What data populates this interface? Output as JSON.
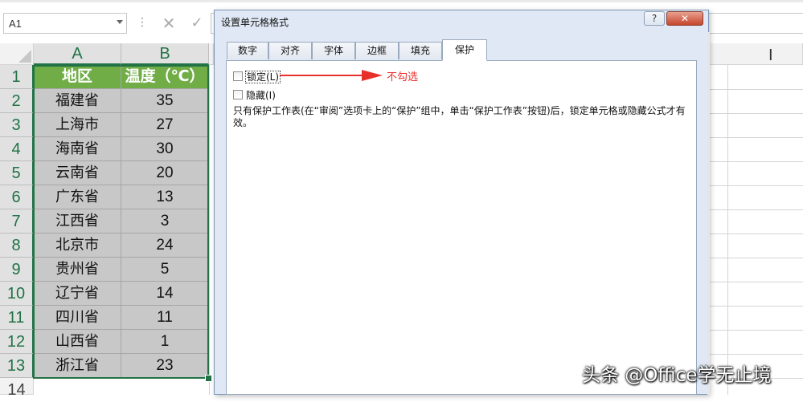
{
  "formula_bar": {
    "name_box": "A1",
    "cancel_icon": "✕",
    "enter_icon": "✓",
    "fx_dots": "⋮"
  },
  "sheet": {
    "columns": [
      "A",
      "B"
    ],
    "rows": [
      "1",
      "2",
      "3",
      "4",
      "5",
      "6",
      "7",
      "8",
      "9",
      "10",
      "11",
      "12",
      "13",
      "14"
    ],
    "header_row": [
      "地区",
      "温度（℃）"
    ],
    "data": [
      [
        "福建省",
        "35"
      ],
      [
        "上海市",
        "27"
      ],
      [
        "海南省",
        "30"
      ],
      [
        "云南省",
        "20"
      ],
      [
        "广东省",
        "13"
      ],
      [
        "江西省",
        "3"
      ],
      [
        "北京市",
        "24"
      ],
      [
        "贵州省",
        "5"
      ],
      [
        "辽宁省",
        "14"
      ],
      [
        "四川省",
        "11"
      ],
      [
        "山西省",
        "1"
      ],
      [
        "浙江省",
        "23"
      ]
    ],
    "colors": {
      "header_fill": "#70ad47",
      "cell_fill": "#c8c8c8",
      "accent": "#217346"
    },
    "cursor_glyph": "I"
  },
  "dialog": {
    "title": "设置单元格格式",
    "help_label": "?",
    "close_label": "✕",
    "tabs": [
      "数字",
      "对齐",
      "字体",
      "边框",
      "填充",
      "保护"
    ],
    "active_tab": "保护",
    "locked_label": "锁定(L)",
    "locked_checked": false,
    "hidden_label": "隐藏(I)",
    "hidden_checked": false,
    "note": "只有保护工作表(在“审阅”选项卡上的“保护”组中，单击“保护工作表”按钮)后，锁定单元格或隐藏公式才有效。"
  },
  "annotation": {
    "text": "不勾选",
    "color": "#e8302b"
  },
  "watermark": "头条 @Office学无止境"
}
